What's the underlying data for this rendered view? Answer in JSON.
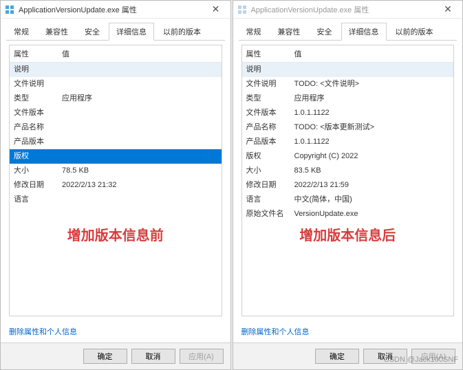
{
  "left": {
    "title": "ApplicationVersionUpdate.exe 属性",
    "tabs": [
      "常规",
      "兼容性",
      "安全",
      "详细信息",
      "以前的版本"
    ],
    "active_tab": "详细信息",
    "header_prop": "属性",
    "header_val": "值",
    "rows": [
      {
        "prop": "说明",
        "val": "",
        "cls": "desc"
      },
      {
        "prop": "文件说明",
        "val": ""
      },
      {
        "prop": "类型",
        "val": "应用程序"
      },
      {
        "prop": "文件版本",
        "val": ""
      },
      {
        "prop": "产品名称",
        "val": ""
      },
      {
        "prop": "产品版本",
        "val": ""
      },
      {
        "prop": "版权",
        "val": "",
        "cls": "selected"
      },
      {
        "prop": "大小",
        "val": "78.5 KB"
      },
      {
        "prop": "修改日期",
        "val": "2022/2/13 21:32"
      },
      {
        "prop": "语言",
        "val": ""
      }
    ],
    "caption": "增加版本信息前",
    "remove_link": "删除属性和个人信息",
    "buttons": {
      "ok": "确定",
      "cancel": "取消",
      "apply": "应用(A)"
    }
  },
  "right": {
    "title": "ApplicationVersionUpdate.exe 属性",
    "tabs": [
      "常规",
      "兼容性",
      "安全",
      "详细信息",
      "以前的版本"
    ],
    "active_tab": "详细信息",
    "header_prop": "属性",
    "header_val": "值",
    "rows": [
      {
        "prop": "说明",
        "val": "",
        "cls": "desc"
      },
      {
        "prop": "文件说明",
        "val": "TODO: <文件说明>"
      },
      {
        "prop": "类型",
        "val": "应用程序"
      },
      {
        "prop": "文件版本",
        "val": "1.0.1.1122"
      },
      {
        "prop": "产品名称",
        "val": "TODO: <版本更新测试>"
      },
      {
        "prop": "产品版本",
        "val": "1.0.1.1122"
      },
      {
        "prop": "版权",
        "val": "Copyright (C) 2022"
      },
      {
        "prop": "大小",
        "val": "83.5 KB"
      },
      {
        "prop": "修改日期",
        "val": "2022/2/13 21:59"
      },
      {
        "prop": "语言",
        "val": "中文(简体，中国)"
      },
      {
        "prop": "原始文件名",
        "val": "VersionUpdate.exe"
      }
    ],
    "caption": "增加版本信息后",
    "remove_link": "删除属性和个人信息",
    "buttons": {
      "ok": "确定",
      "cancel": "取消",
      "apply": "应用(A)"
    }
  },
  "watermark": "CSDN @Jack100SNF"
}
